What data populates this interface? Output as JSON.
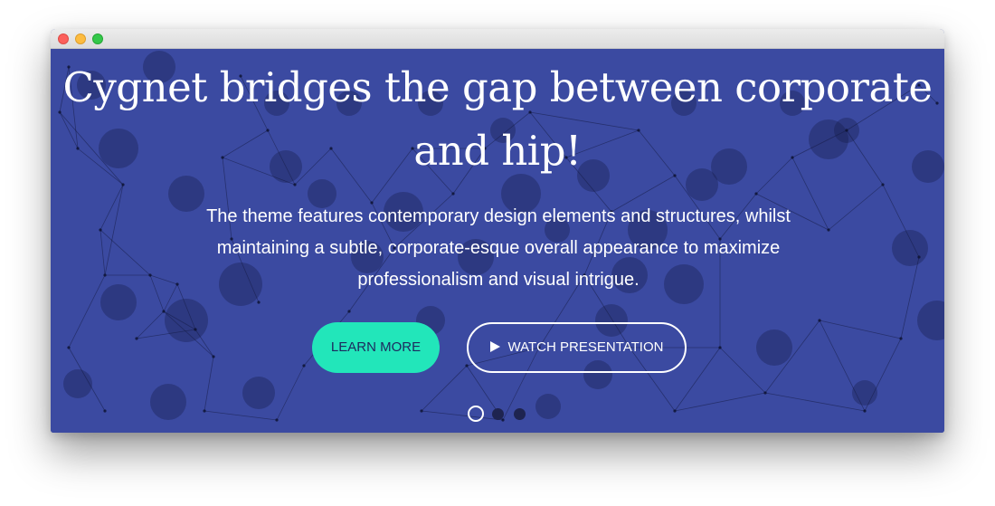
{
  "window": {
    "controls": [
      "close",
      "minimize",
      "maximize"
    ]
  },
  "hero": {
    "headline_line1": "Cygnet bridges the gap between corporate",
    "headline_line2": "and hip!",
    "lead_line1": "The theme features contemporary design elements and structures, whilst",
    "lead_line2": "maintaining a subtle, corporate-esque overall appearance to maximize",
    "lead_line3": "professionalism and visual intrigue.",
    "primary_button": "LEARN MORE",
    "secondary_button": "WATCH PRESENTATION",
    "secondary_button_icon": "play-icon",
    "slide_indicators": [
      {
        "active": true
      },
      {
        "active": false
      },
      {
        "active": false
      }
    ]
  },
  "colors": {
    "hero_background": "#3b4aa1",
    "primary_button": "#22e6ba",
    "primary_button_text": "#1d2a5e",
    "indicator_inactive": "#1e2450"
  }
}
